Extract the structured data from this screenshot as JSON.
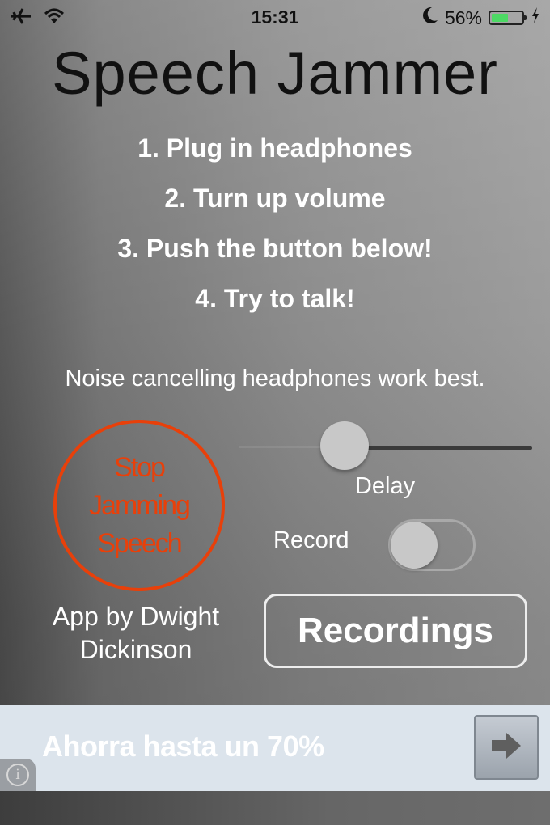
{
  "status_bar": {
    "time": "15:31",
    "battery_percent_label": "56%",
    "battery_level": 0.56,
    "icons": [
      "airplane-icon",
      "wifi-icon",
      "moon-icon",
      "battery-icon",
      "charging-bolt-icon"
    ]
  },
  "app": {
    "title": "Speech Jammer",
    "steps": [
      "1. Plug in headphones",
      "2. Turn up volume",
      "3. Push the button below!",
      "4. Try to talk!"
    ],
    "tip": "Noise cancelling headphones work best.",
    "jam_button": {
      "lines": [
        "Stop",
        "Jamming",
        "Speech"
      ],
      "color": "#e8400a"
    },
    "delay_slider": {
      "label": "Delay",
      "value_fraction": 0.36
    },
    "record_toggle": {
      "label": "Record",
      "on": false
    },
    "credit": {
      "line1": "App by Dwight",
      "line2": "Dickinson"
    },
    "recordings_button": "Recordings"
  },
  "ad_banner": {
    "text": "Ahorra hasta un 70%",
    "info_icon": "info-icon",
    "arrow_icon": "arrow-right-icon"
  }
}
